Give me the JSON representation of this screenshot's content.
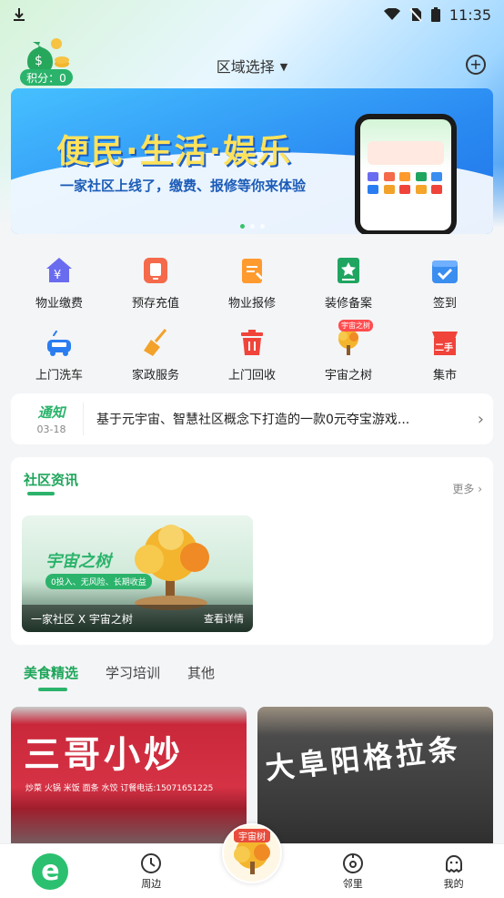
{
  "status": {
    "time": "11:35"
  },
  "header": {
    "points_label": "积分：0",
    "region_label": "区域选择"
  },
  "banner": {
    "title": "便民·生活·娱乐",
    "subtitle": "一家社区上线了，缴费、报修等你来体验"
  },
  "services": [
    {
      "label": "物业缴费",
      "icon": "yuan-house-icon",
      "color": "#6a6cf0"
    },
    {
      "label": "预存充值",
      "icon": "card-icon",
      "color": "#f46a4a"
    },
    {
      "label": "物业报修",
      "icon": "repair-icon",
      "color": "#ff9a2e"
    },
    {
      "label": "装修备案",
      "icon": "star-doc-icon",
      "color": "#1fa560"
    },
    {
      "label": "签到",
      "icon": "calendar-check-icon",
      "color": "#3a8ef0"
    },
    {
      "label": "上门洗车",
      "icon": "car-icon",
      "color": "#2a7df0"
    },
    {
      "label": "家政服务",
      "icon": "broom-icon",
      "color": "#f2a22a"
    },
    {
      "label": "上门回收",
      "icon": "trash-icon",
      "color": "#f0443a"
    },
    {
      "label": "宇宙之树",
      "icon": "tree-icon",
      "color": "#f4a52a",
      "tag": "宇宙之树"
    },
    {
      "label": "集市",
      "icon": "market-icon",
      "color": "#f0433a",
      "badge": "二手"
    }
  ],
  "notice": {
    "badge": "通知",
    "date": "03-18",
    "text": "基于元宇宙、智慧社区概念下打造的一款0元夺宝游戏..."
  },
  "news": {
    "title": "社区资讯",
    "more": "更多",
    "card": {
      "brand": "宇宙之树",
      "tagline": "0投入、无风险、长期收益",
      "caption": "一家社区 X 宇宙之树",
      "action": "查看详情"
    }
  },
  "tabs": [
    {
      "label": "美食精选",
      "active": true
    },
    {
      "label": "学习培训",
      "active": false
    },
    {
      "label": "其他",
      "active": false
    }
  ],
  "stores": [
    {
      "sign": "三哥小炒",
      "sub": "炒菜 火锅 米饭 面条 水饺  订餐电话:15071651225"
    },
    {
      "sign": "大阜阳格拉条",
      "sub": ""
    }
  ],
  "bottom_nav": [
    {
      "label": "",
      "icon": "home-logo-icon"
    },
    {
      "label": "周边",
      "icon": "nearby-icon"
    },
    {
      "label": "宇宙树",
      "icon": "tree-center-icon"
    },
    {
      "label": "邻里",
      "icon": "neighbor-icon"
    },
    {
      "label": "我的",
      "icon": "profile-icon"
    }
  ]
}
